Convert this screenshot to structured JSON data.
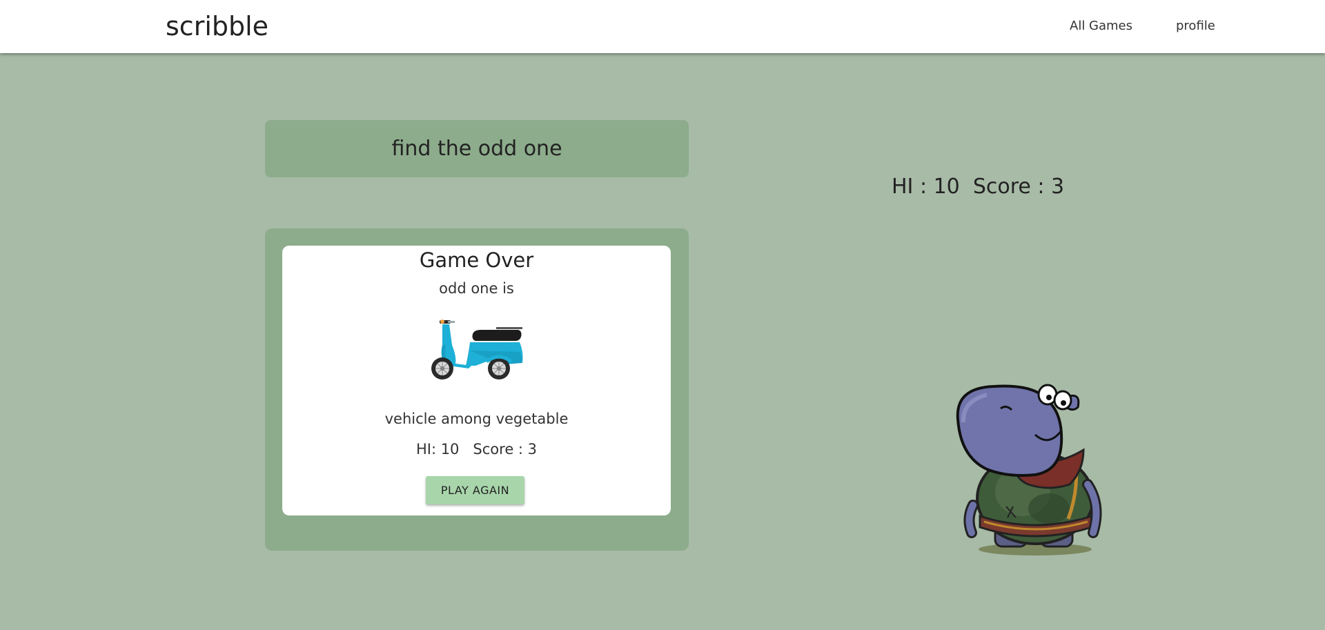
{
  "navbar": {
    "brand": "scribble",
    "links": [
      "All Games",
      "profile"
    ]
  },
  "game": {
    "title": "find the odd one",
    "scoreboard": "HI : 10  Score : 3"
  },
  "modal": {
    "title": "Game Over",
    "subtitle": "odd one is",
    "image": "scooter-image",
    "reason": "vehicle among vegetable",
    "score_line": "HI: 10   Score : 3",
    "button_label": "PLAY AGAIN"
  },
  "mascot": "hippo-character",
  "colors": {
    "background": "#a8bba7",
    "panel": "#8dac8c",
    "button": "#a8d5aa",
    "scooter": "#1eb0d6"
  }
}
